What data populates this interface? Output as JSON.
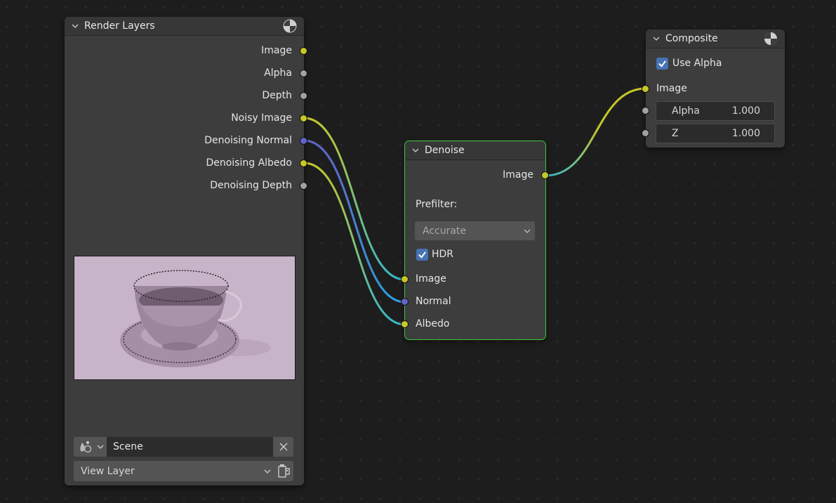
{
  "nodes": {
    "render_layers": {
      "title": "Render Layers",
      "outputs": [
        {
          "label": "Image",
          "type": "color"
        },
        {
          "label": "Alpha",
          "type": "value"
        },
        {
          "label": "Depth",
          "type": "value"
        },
        {
          "label": "Noisy Image",
          "type": "color"
        },
        {
          "label": "Denoising Normal",
          "type": "vector"
        },
        {
          "label": "Denoising Albedo",
          "type": "color"
        },
        {
          "label": "Denoising Depth",
          "type": "value"
        }
      ],
      "preview": "teacup-render-preview",
      "scene_field": {
        "icon": "scene-icon",
        "value": "Scene",
        "clear_icon": "x-icon"
      },
      "view_layer_field": {
        "value": "View Layer",
        "icon": "view-layer-icon"
      }
    },
    "denoise": {
      "title": "Denoise",
      "output": "Image",
      "prefilter_label": "Prefilter:",
      "prefilter_value": "Accurate",
      "hdr_label": "HDR",
      "hdr_checked": true,
      "inputs": [
        {
          "label": "Image",
          "type": "color"
        },
        {
          "label": "Normal",
          "type": "vector"
        },
        {
          "label": "Albedo",
          "type": "color"
        }
      ]
    },
    "composite": {
      "title": "Composite",
      "use_alpha_label": "Use Alpha",
      "use_alpha_checked": true,
      "input_image": "Image",
      "fields": [
        {
          "label": "Alpha",
          "value": "1.000"
        },
        {
          "label": "Z",
          "value": "1.000"
        }
      ]
    }
  },
  "links": [
    {
      "from": "Render Layers.Noisy Image",
      "to": "Denoise.Image"
    },
    {
      "from": "Render Layers.Denoising Normal",
      "to": "Denoise.Normal"
    },
    {
      "from": "Render Layers.Denoising Albedo",
      "to": "Denoise.Albedo"
    },
    {
      "from": "Denoise.Image",
      "to": "Composite.Image"
    }
  ],
  "colors": {
    "color_socket": "#c7c729",
    "value_socket": "#a1a1a1",
    "vector_socket": "#6363c7",
    "selected_outline": "#3fc93f",
    "checkbox": "#4772b3",
    "wire_highlight": "#30b8d0"
  }
}
